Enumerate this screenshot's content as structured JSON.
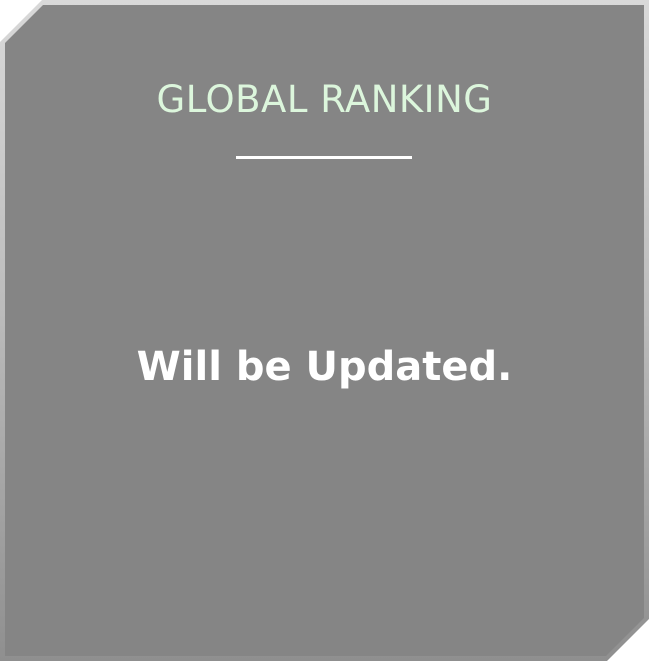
{
  "panel": {
    "title": "GLOBAL RANKING",
    "message": "Will be Updated."
  },
  "colors": {
    "panel_background": "#858585",
    "title_color": "#dcf6dc",
    "message_color": "#ffffff",
    "divider_color": "#ffffff"
  }
}
